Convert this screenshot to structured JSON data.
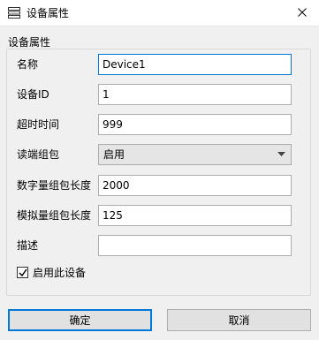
{
  "window": {
    "title": "设备属性",
    "icon": "list-icon",
    "close_icon": "close-icon"
  },
  "group": {
    "title": "设备属性"
  },
  "fields": {
    "name": {
      "label": "名称",
      "value": "Device1"
    },
    "device_id": {
      "label": "设备ID",
      "value": "1"
    },
    "timeout": {
      "label": "超时时间",
      "value": "999"
    },
    "read_packing": {
      "label": "读端组包",
      "value": "启用"
    },
    "digital_packet_len": {
      "label": "数字量组包长度",
      "value": "2000"
    },
    "analog_packet_len": {
      "label": "模拟量组包长度",
      "value": "125"
    },
    "description": {
      "label": "描述",
      "value": ""
    }
  },
  "enable_checkbox": {
    "label": "启用此设备",
    "checked": true
  },
  "buttons": {
    "ok": "确定",
    "cancel": "取消"
  },
  "colors": {
    "focus_border": "#0078d7",
    "dialog_bg": "#f0f0f0",
    "titlebar_bg": "#ffffff"
  }
}
